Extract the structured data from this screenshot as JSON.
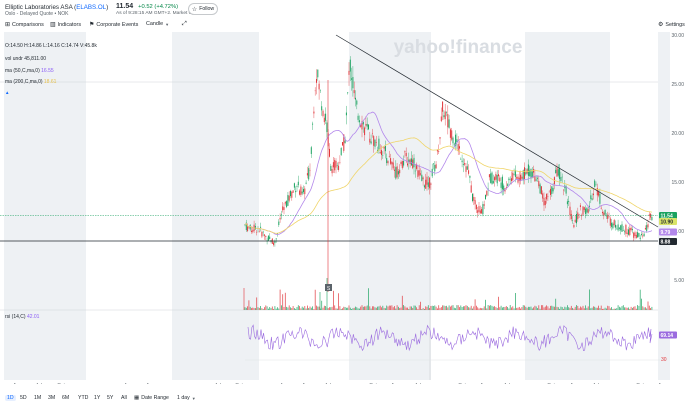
{
  "header": {
    "company": "Elliptic Laboratories ASA (",
    "symbol": "ELABS.OL",
    "company_close": ")",
    "subtitle": "Oslo - Delayed Quote • NOK",
    "price": "11.54",
    "change": "+0.52",
    "change_pct": "(+4.72%)",
    "asof": "As of 9:28:15 AM GMT+2. Market Open.",
    "follow_label": "Follow"
  },
  "toolbar": {
    "comparisons": "Comparisons",
    "indicators": "Indicators",
    "corporate_events": "Corporate Events",
    "chart_type": "Candle",
    "settings": "Settings"
  },
  "legend": {
    "ohlc": "O:14.50  H:14.86  L:14.16  C:14.74  V:45.8k",
    "vol_label": "vol undr",
    "vol_value": "45,811.00",
    "ma50_label": "ma (50,C,ma,0)",
    "ma50_value": "16.55",
    "ma200_label": "ma (200,C,ma,0)",
    "ma200_value": "18.61",
    "rsi_label": "rsi (14,C)",
    "rsi_value": "42.01"
  },
  "watermark": "yahoo!finance",
  "price_axis": [
    "30.00",
    "25.00",
    "20.00",
    "15.00",
    "10.00",
    "5.00"
  ],
  "badges": {
    "last": "11.54",
    "ma50": "10.90",
    "ma200": "9.79",
    "support": "8.88",
    "rsi": "69.14",
    "rsi_level": "30",
    "date": "5/26/2025",
    "split_marker": "S"
  },
  "time_axis": {
    "months": [
      {
        "label": "Apr"
      },
      {
        "label": "Jul"
      },
      {
        "label": "Oct"
      },
      {
        "label": "Jan"
      },
      {
        "label": "Apr"
      },
      {
        "label": "Jul"
      },
      {
        "label": "Oct"
      },
      {
        "label": "Jan"
      },
      {
        "label": "Apr"
      },
      {
        "label": "Jul"
      },
      {
        "label": "Oct"
      },
      {
        "label": "Apr"
      },
      {
        "label": "Jul"
      },
      {
        "label": "Oct"
      },
      {
        "label": "Apr"
      },
      {
        "label": "Jul"
      },
      {
        "label": "Oct"
      },
      {
        "label": "Apr"
      },
      {
        "label": "Jul"
      },
      {
        "label": "Oct"
      },
      {
        "label": "Apr"
      },
      {
        "label": "Jul"
      },
      {
        "label": "Oct"
      },
      {
        "label": "Apr"
      },
      {
        "label": "Jul"
      },
      {
        "label": "Oct"
      },
      {
        "label": "Apr"
      },
      {
        "label": "Jul"
      }
    ],
    "years": [
      "2019",
      "2020",
      "2021",
      "2022",
      "2023",
      "2024",
      "2025"
    ]
  },
  "ranges": [
    "1D",
    "5D",
    "1M",
    "3M",
    "6M",
    "YTD",
    "1Y",
    "5Y",
    "All"
  ],
  "active_range": "1D",
  "date_range_label": "Date Range",
  "interval": "1 day",
  "colors": {
    "up": "#1aa260",
    "down": "#e0353a",
    "ma50": "#b388eb",
    "ma200": "#f0d56a",
    "rsi": "#9b6bdf",
    "accent": "#0f69ff",
    "shade": "#eef1f4"
  }
}
